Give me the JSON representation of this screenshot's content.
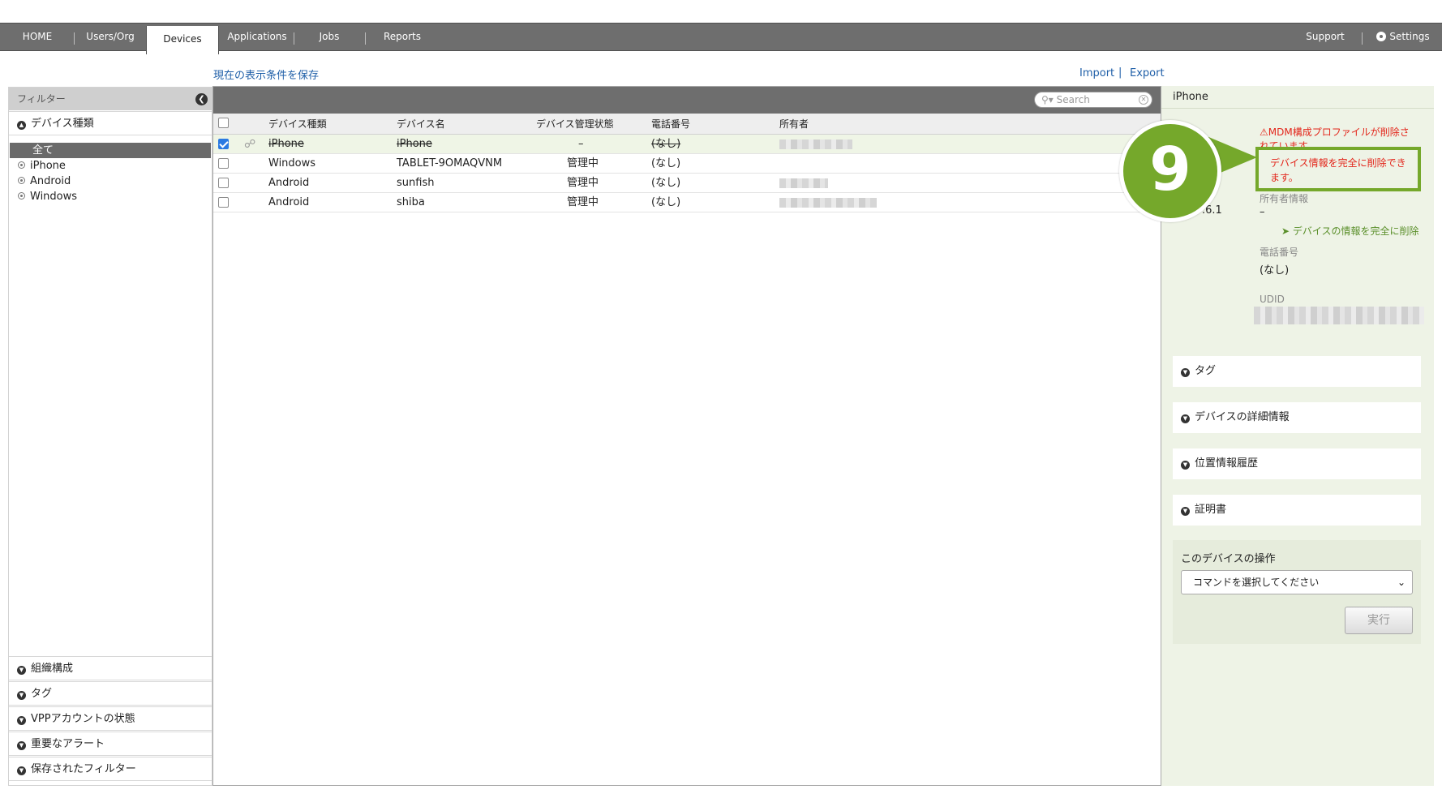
{
  "nav": {
    "items": [
      "HOME",
      "Users/Org",
      "Devices",
      "Applications",
      "Jobs",
      "Reports"
    ],
    "active": "Devices",
    "support": "Support",
    "settings": "Settings"
  },
  "links": {
    "save_filter": "現在の表示条件を保存",
    "import": "Import",
    "export": "Export",
    "sep": "|"
  },
  "sidebar": {
    "header": "フィルター",
    "device_type_section": "デバイス種類",
    "device_types": [
      "全て",
      "iPhone",
      "Android",
      "Windows"
    ],
    "selected": "全て",
    "bottom_sections": [
      "組織構成",
      "タグ",
      "VPPアカウントの状態",
      "重要なアラート",
      "保存されたフィルター"
    ]
  },
  "table": {
    "search_placeholder": "Search",
    "columns": [
      "デバイス種類",
      "デバイス名",
      "デバイス管理状態",
      "電話番号",
      "所有者"
    ],
    "rows": [
      {
        "type": "iPhone",
        "name": "iPhone",
        "status": "–",
        "phone": "(なし)",
        "checked": true,
        "strike": true
      },
      {
        "type": "Windows",
        "name": "TABLET-9OMAQVNM",
        "status": "管理中",
        "phone": "(なし)",
        "checked": false
      },
      {
        "type": "Android",
        "name": "sunfish",
        "status": "管理中",
        "phone": "(なし)",
        "checked": false
      },
      {
        "type": "Android",
        "name": "shiba",
        "status": "管理中",
        "phone": "(なし)",
        "checked": false
      }
    ]
  },
  "right": {
    "title": "iPhone",
    "warning_line1": "MDM構成プロファイルが削除さ",
    "warning_line2": "れています。",
    "delete_notice_line1": "デバイス情報を完全に削除でき",
    "delete_notice_line2": "ます。",
    "version_fragment": ".6.1",
    "owner_label": "所有者情報",
    "owner_value": "–",
    "delete_link": "デバイスの情報を完全に削除",
    "phone_label": "電話番号",
    "phone_value": "(なし)",
    "udid_label": "UDID",
    "accordions": [
      "タグ",
      "デバイスの詳細情報",
      "位置情報履歴",
      "証明書"
    ],
    "ops_title": "このデバイスの操作",
    "command_placeholder": "コマンドを選択してください",
    "exec_button": "実行"
  },
  "callout": {
    "number": "9",
    "color": "#75a82b"
  },
  "colors": {
    "nav_bg": "#6e6e6e",
    "link": "#1f5fa8",
    "warning": "#e3261b",
    "panel_bg": "#eef3e6",
    "check_blue": "#2a7ae2"
  }
}
